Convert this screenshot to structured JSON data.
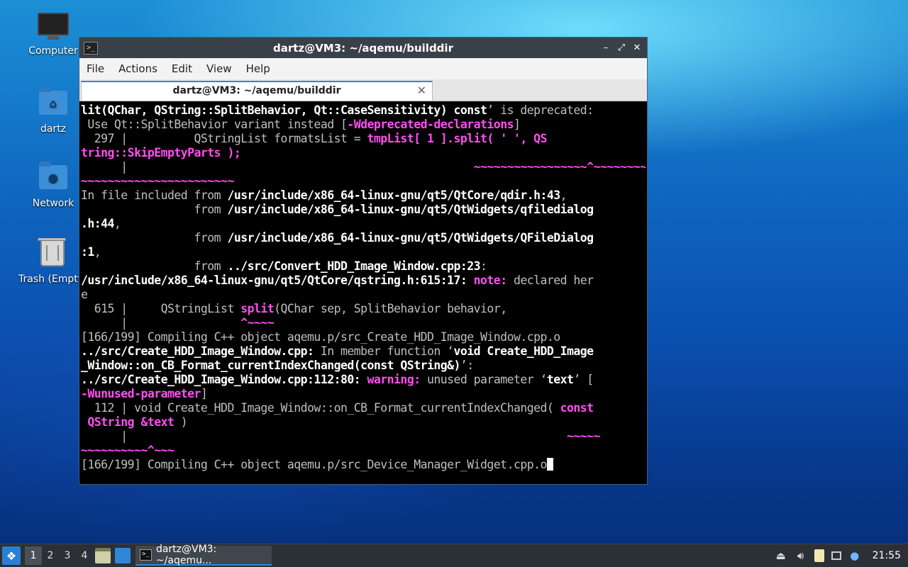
{
  "desktop": {
    "icons": [
      {
        "label": "Computer",
        "icon": "computer-icon"
      },
      {
        "label": "dartz",
        "icon": "home-folder-icon"
      },
      {
        "label": "Network",
        "icon": "network-folder-icon"
      },
      {
        "label": "Trash (Empty)",
        "icon": "trash-icon"
      }
    ]
  },
  "window": {
    "title": "dartz@VM3: ~/aqemu/builddir",
    "controls": {
      "minimize": "–",
      "maximize": "⤢",
      "close": "✕"
    },
    "menu": [
      "File",
      "Actions",
      "Edit",
      "View",
      "Help"
    ],
    "tab": {
      "label": "dartz@VM3: ~/aqemu/builddir",
      "close": "✕"
    }
  },
  "terminal": {
    "lines": [
      [
        {
          "t": "lit(QChar, QString::SplitBehavior, Qt::CaseSensitivity) const",
          "s": "b"
        },
        {
          "t": "’ is deprecated:",
          "s": ""
        }
      ],
      [
        {
          "t": " Use Qt::SplitBehavior variant instead [",
          "s": ""
        },
        {
          "t": "-Wdeprecated-declarations",
          "s": "m"
        },
        {
          "t": "]",
          "s": ""
        }
      ],
      [
        {
          "t": "  297 |          QStringList formatsList = ",
          "s": ""
        },
        {
          "t": "tmpList[ 1 ].split( ' ', QS",
          "s": "m"
        }
      ],
      [
        {
          "t": "tring::SkipEmptyParts );",
          "s": "m"
        }
      ],
      [
        {
          "t": "      |                                                    ",
          "s": ""
        },
        {
          "t": "~~~~~~~~~~~~~~~~~^~~~~~~~~",
          "s": "m"
        }
      ],
      [
        {
          "t": "~~~~~~~~~~~~~~~~~~~~~~~",
          "s": "m"
        }
      ],
      [
        {
          "t": "In file included from ",
          "s": ""
        },
        {
          "t": "/usr/include/x86_64-linux-gnu/qt5/QtCore/qdir.h:43",
          "s": "b"
        },
        {
          "t": ",",
          "s": ""
        }
      ],
      [
        {
          "t": "                 from ",
          "s": ""
        },
        {
          "t": "/usr/include/x86_64-linux-gnu/qt5/QtWidgets/qfiledialog",
          "s": "b"
        }
      ],
      [
        {
          "t": ".h:44",
          "s": "b"
        },
        {
          "t": ",",
          "s": ""
        }
      ],
      [
        {
          "t": "                 from ",
          "s": ""
        },
        {
          "t": "/usr/include/x86_64-linux-gnu/qt5/QtWidgets/QFileDialog",
          "s": "b"
        }
      ],
      [
        {
          "t": ":1",
          "s": "b"
        },
        {
          "t": ",",
          "s": ""
        }
      ],
      [
        {
          "t": "                 from ",
          "s": ""
        },
        {
          "t": "../src/Convert_HDD_Image_Window.cpp:23",
          "s": "b"
        },
        {
          "t": ":",
          "s": ""
        }
      ],
      [
        {
          "t": "/usr/include/x86_64-linux-gnu/qt5/QtCore/qstring.h:615:17:",
          "s": "b"
        },
        {
          "t": " ",
          "s": ""
        },
        {
          "t": "note:",
          "s": "m"
        },
        {
          "t": " declared her",
          "s": ""
        }
      ],
      [
        {
          "t": "e",
          "s": ""
        }
      ],
      [
        {
          "t": "  615 |     QStringList ",
          "s": ""
        },
        {
          "t": "split",
          "s": "m"
        },
        {
          "t": "(QChar sep, SplitBehavior behavior,",
          "s": ""
        }
      ],
      [
        {
          "t": "      |                 ",
          "s": ""
        },
        {
          "t": "^~~~~",
          "s": "m"
        }
      ],
      [
        {
          "t": "[166/199] Compiling C++ object aqemu.p/src_Create_HDD_Image_Window.cpp.o",
          "s": ""
        }
      ],
      [
        {
          "t": "../src/Create_HDD_Image_Window.cpp:",
          "s": "b"
        },
        {
          "t": " In member function ‘",
          "s": ""
        },
        {
          "t": "void Create_HDD_Image",
          "s": "b"
        }
      ],
      [
        {
          "t": "_Window::on_CB_Format_currentIndexChanged(const QString&)",
          "s": "b"
        },
        {
          "t": "’:",
          "s": ""
        }
      ],
      [
        {
          "t": "../src/Create_HDD_Image_Window.cpp:112:80:",
          "s": "b"
        },
        {
          "t": " ",
          "s": ""
        },
        {
          "t": "warning:",
          "s": "m"
        },
        {
          "t": " unused parameter ‘",
          "s": ""
        },
        {
          "t": "text",
          "s": "b"
        },
        {
          "t": "’ [",
          "s": ""
        }
      ],
      [
        {
          "t": "-Wunused-parameter",
          "s": "m"
        },
        {
          "t": "]",
          "s": ""
        }
      ],
      [
        {
          "t": "  112 | void Create_HDD_Image_Window::on_CB_Format_currentIndexChanged( ",
          "s": ""
        },
        {
          "t": "const",
          "s": "m"
        }
      ],
      [
        {
          "t": " QString &text",
          "s": "m"
        },
        {
          "t": " )",
          "s": ""
        }
      ],
      [
        {
          "t": "      |                                                                  ",
          "s": ""
        },
        {
          "t": "~~~~~",
          "s": "m"
        }
      ],
      [
        {
          "t": "~~~~~~~~~~^~~~",
          "s": "m"
        }
      ],
      [
        {
          "t": "[166/199] Compiling C++ object aqemu.p/src_Device_Manager_Widget.cpp.o",
          "s": ""
        },
        {
          "t": "",
          "s": "cursor"
        }
      ]
    ]
  },
  "taskbar": {
    "start_icon": "lubuntu-start-icon",
    "workspaces": [
      "1",
      "2",
      "3",
      "4"
    ],
    "active_workspace": "1",
    "quicklaunch": [
      "file-manager-icon",
      "desktop-icon"
    ],
    "task": {
      "label": "dartz@VM3: ~/aqemu...",
      "icon": "terminal-icon"
    },
    "tray": [
      "removable-media-icon",
      "volume-icon",
      "clipboard-icon",
      "network-icon",
      "update-notifier-icon"
    ],
    "clock": "21:55"
  },
  "colors": {
    "terminal_highlight": "#ff4ef0",
    "accent": "#2e87d9"
  }
}
